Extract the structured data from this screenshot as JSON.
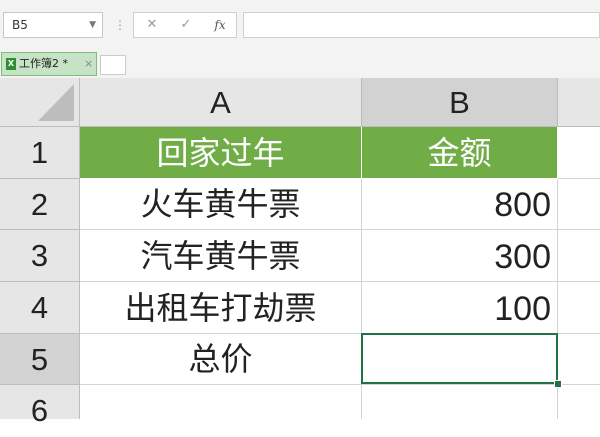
{
  "formula_bar": {
    "name_box": "B5",
    "cancel_icon": "✕",
    "confirm_icon": "✓",
    "fx_label": "fx",
    "formula_value": ""
  },
  "tabs": [
    {
      "label": "工作簿2 *",
      "close": "×",
      "icon": "workbook-icon"
    }
  ],
  "columns": [
    "A",
    "B"
  ],
  "rows": [
    "1",
    "2",
    "3",
    "4",
    "5",
    "6"
  ],
  "cells": {
    "A1": "回家过年",
    "B1": "金额",
    "A2": "火车黄牛票",
    "B2": "800",
    "A3": "汽车黄牛票",
    "B3": "300",
    "A4": "出租车打劫票",
    "B4": "100",
    "A5": "总价",
    "B5": ""
  },
  "colors": {
    "header_fill": "#70ad47",
    "selection": "#217346",
    "tab_fill": "#c6e3c5"
  }
}
